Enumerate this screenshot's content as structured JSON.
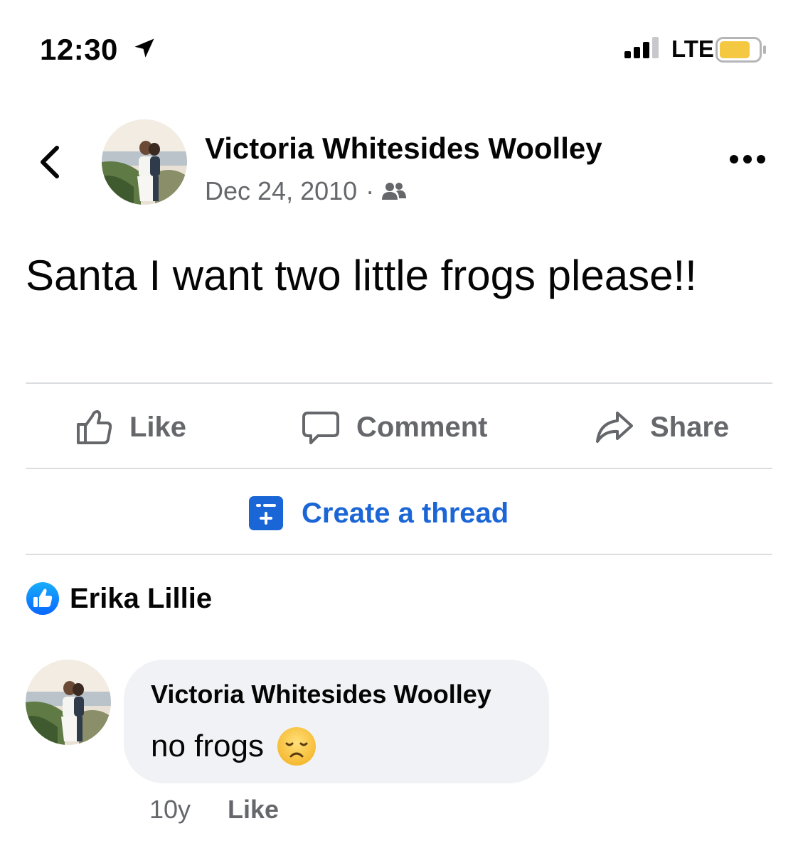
{
  "status_bar": {
    "time": "12:30",
    "network": "LTE",
    "location_icon": "location-arrow-icon",
    "signal_icon": "cellular-signal-icon",
    "battery_icon": "battery-icon",
    "battery_level": 0.8,
    "battery_color": "#f5c842"
  },
  "header": {
    "back_icon": "chevron-left-icon",
    "author": "Victoria Whitesides Woolley",
    "date": "Dec 24, 2010",
    "separator": "·",
    "audience_icon": "friends-icon",
    "more_icon": "more-horizontal-icon"
  },
  "post": {
    "text": "Santa I want two little frogs please!!"
  },
  "actions": {
    "like": "Like",
    "comment": "Comment",
    "share": "Share"
  },
  "thread": {
    "label": "Create a thread",
    "icon": "create-thread-icon",
    "color": "#1b66d6"
  },
  "reaction": {
    "icon": "like-badge-icon",
    "name": "Erika Lillie"
  },
  "comment": {
    "author": "Victoria Whitesides Woolley",
    "text": "no frogs",
    "emoji": "disappointed-face-icon",
    "time": "10y",
    "like_label": "Like"
  },
  "colors": {
    "secondary_text": "#65676b",
    "divider": "#dcdde1",
    "bubble": "#f0f2f5",
    "like_blue": "#1877f2"
  }
}
